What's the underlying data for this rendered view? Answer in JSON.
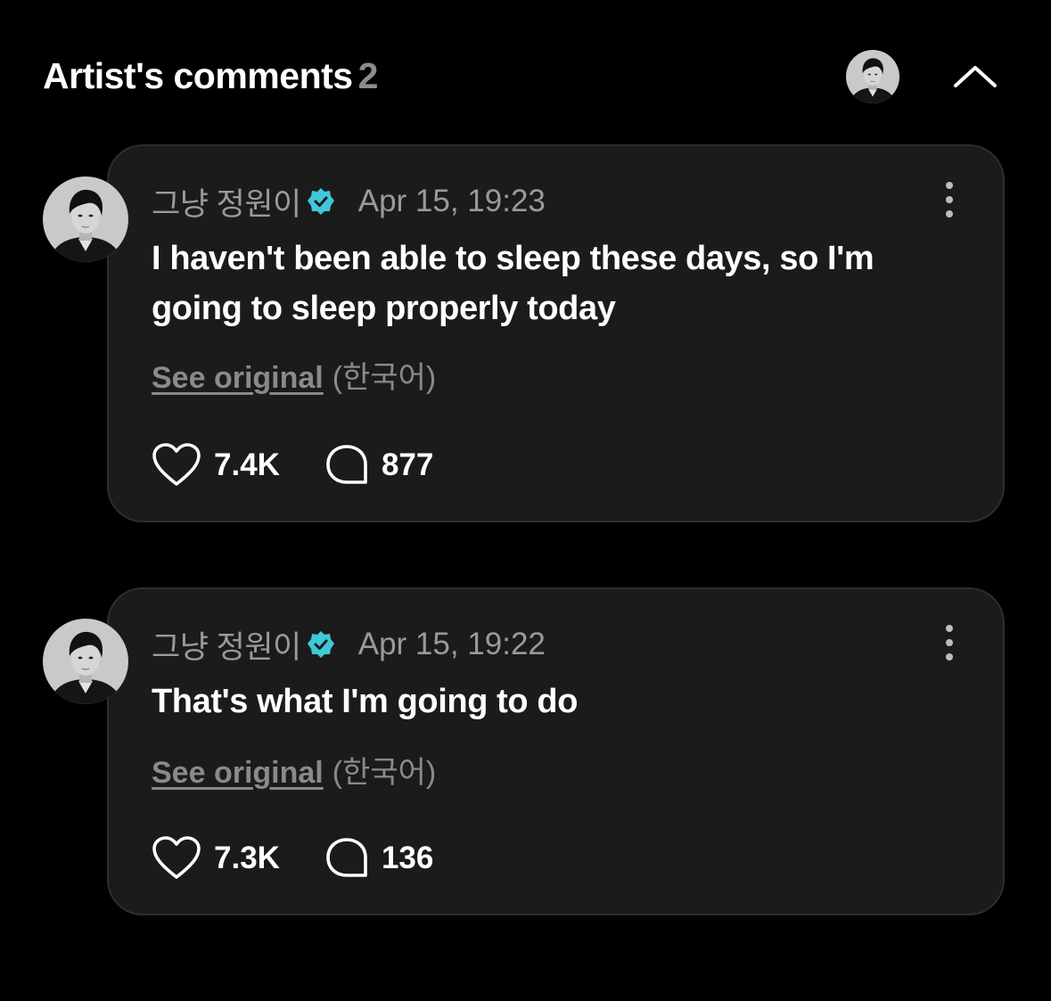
{
  "header": {
    "title": "Artist's comments",
    "count": "2"
  },
  "icons": {
    "collapse": "chevron-up-icon",
    "verified": "verified-badge-icon",
    "more": "more-vertical-icon",
    "like": "heart-icon",
    "reply": "comment-bubble-icon"
  },
  "colors": {
    "background": "#000000",
    "card": "#1b1b1b",
    "verified": "#3fc8d8",
    "muted": "#9a9a9a"
  },
  "comments": [
    {
      "author": "그냥 정원이",
      "timestamp": "Apr 15, 19:23",
      "text": "I haven't been able to sleep these days, so I'm going to sleep properly today",
      "see_original": "See original",
      "original_language": "(한국어)",
      "likes": "7.4K",
      "replies": "877"
    },
    {
      "author": "그냥 정원이",
      "timestamp": "Apr 15, 19:22",
      "text": "That's what I'm going to do",
      "see_original": "See original",
      "original_language": "(한국어)",
      "likes": "7.3K",
      "replies": "136"
    }
  ]
}
